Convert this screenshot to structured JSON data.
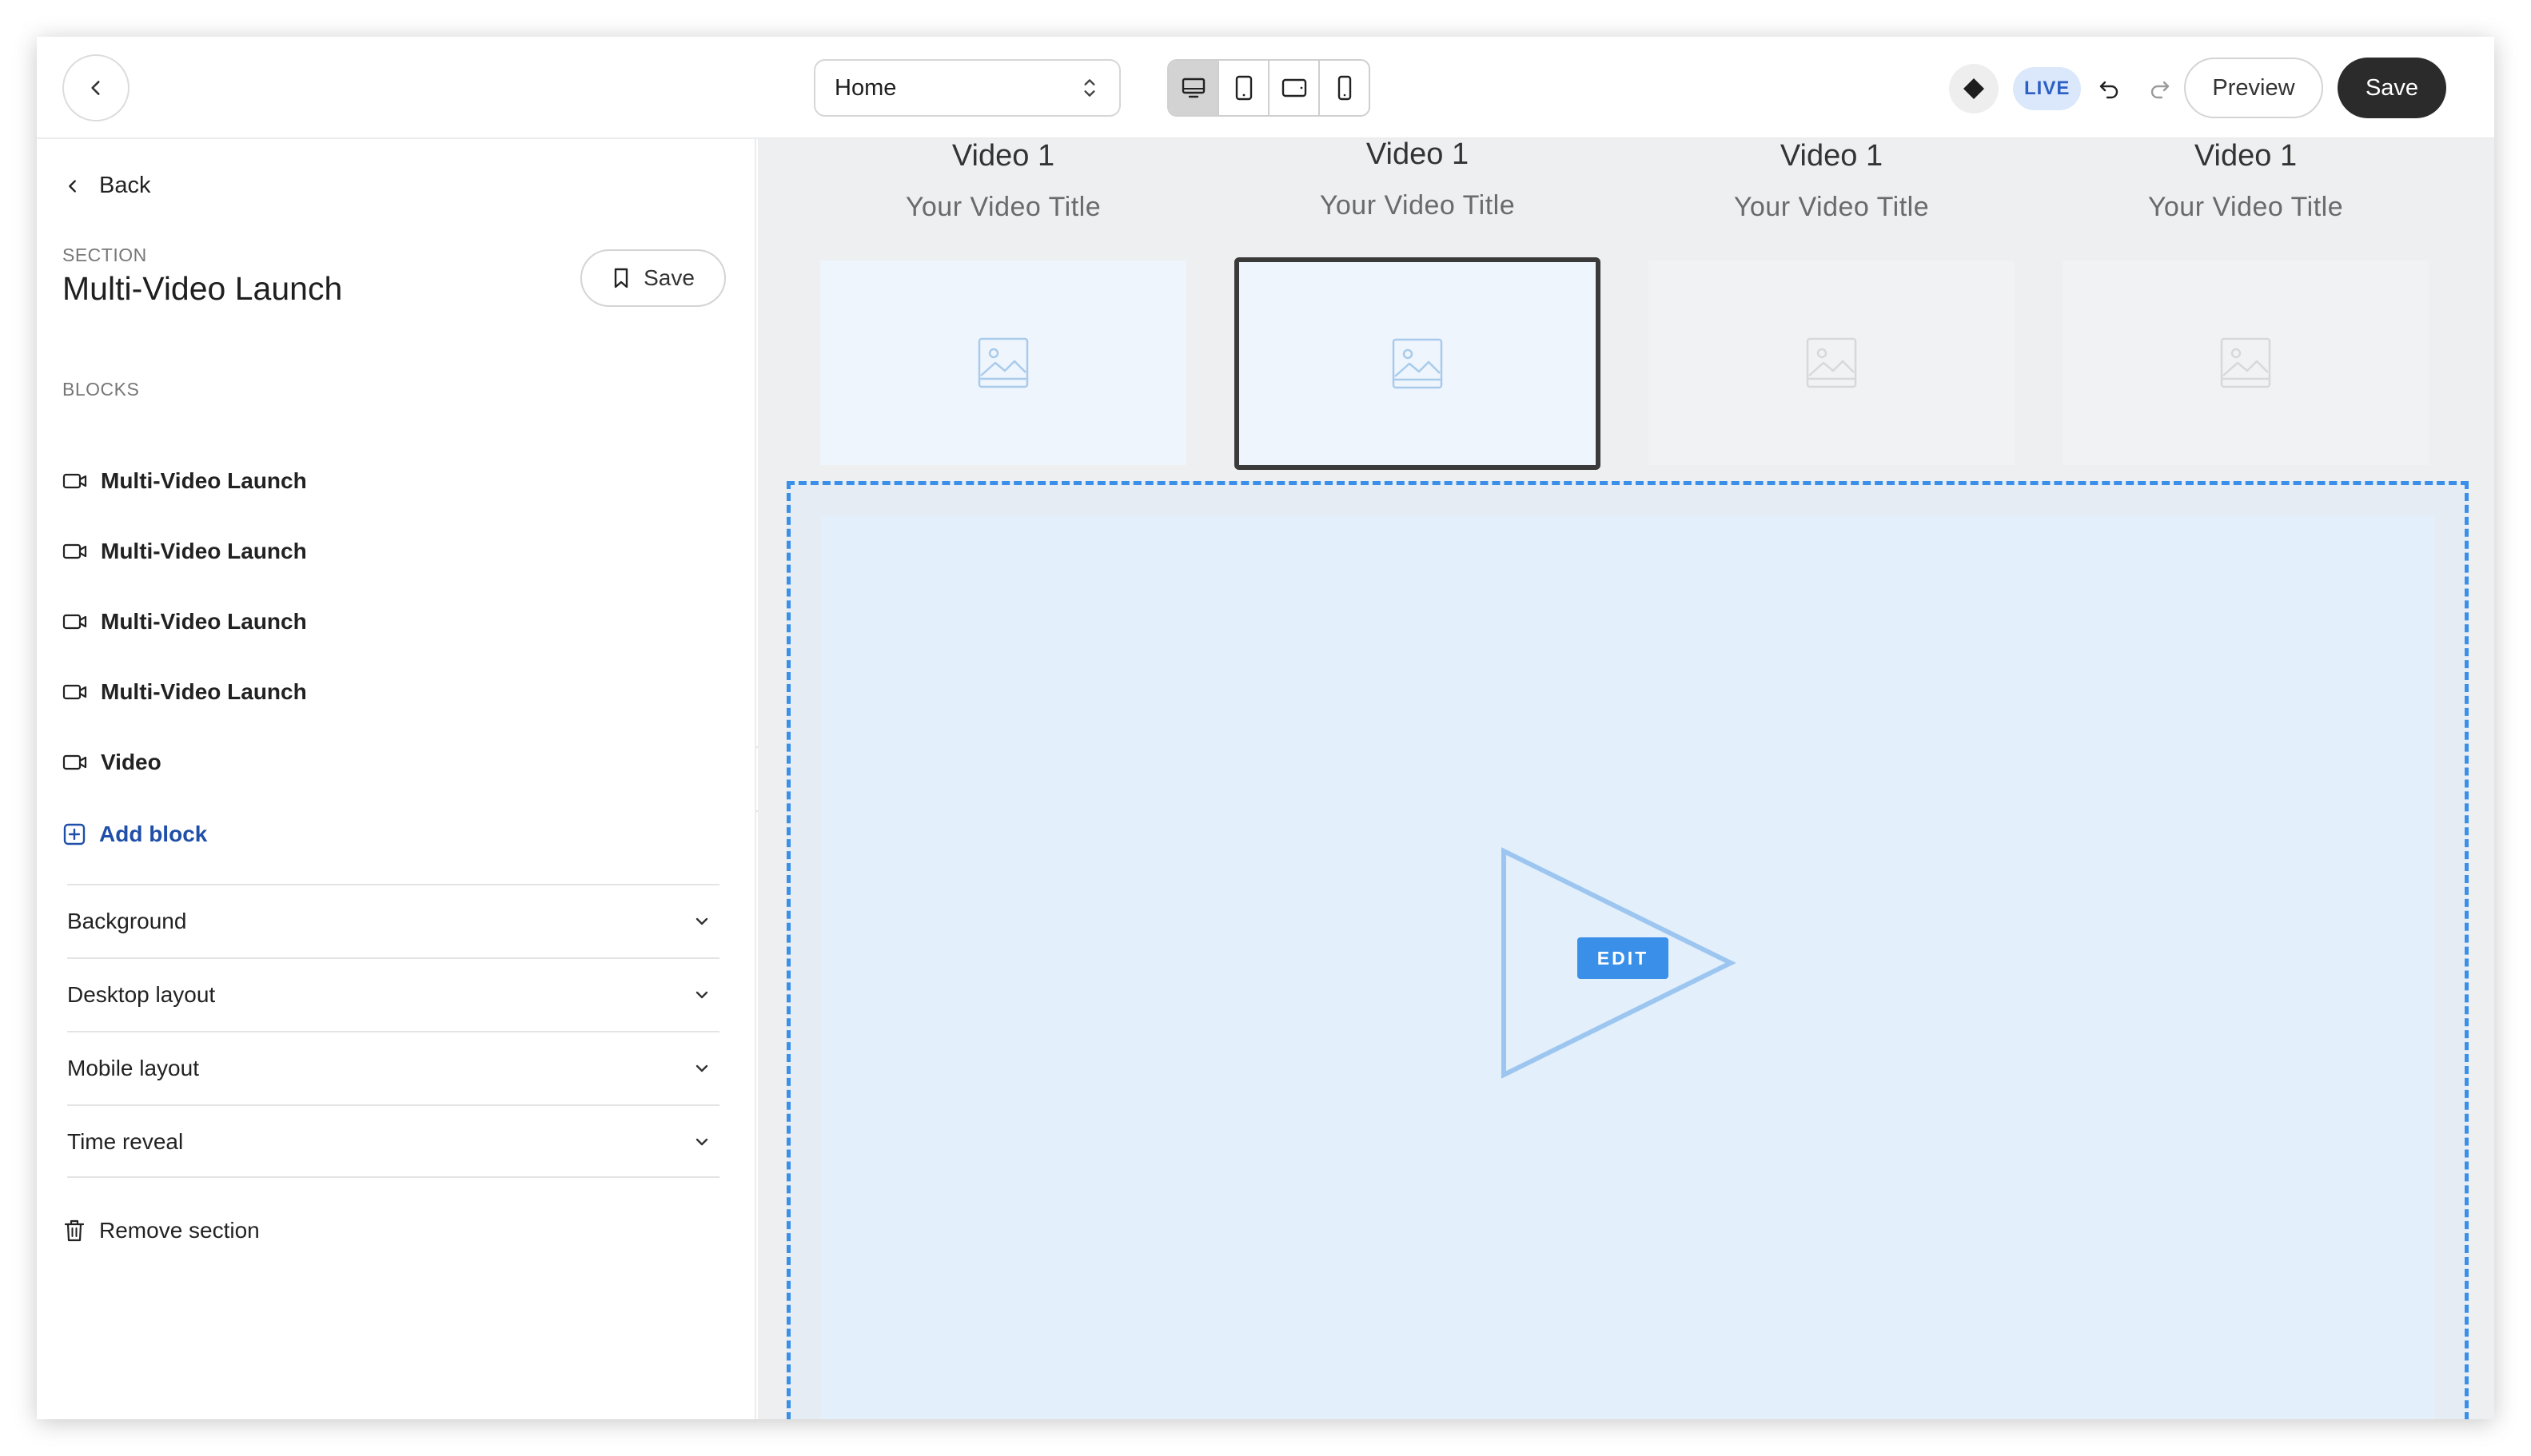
{
  "topbar": {
    "page_select": "Home",
    "live_label": "LIVE",
    "preview_label": "Preview",
    "save_label": "Save"
  },
  "sidebar": {
    "back_label": "Back",
    "section_kicker": "SECTION",
    "section_title": "Multi-Video Launch",
    "save_label": "Save",
    "blocks_kicker": "BLOCKS",
    "blocks": [
      {
        "label": "Multi-Video Launch"
      },
      {
        "label": "Multi-Video Launch"
      },
      {
        "label": "Multi-Video Launch"
      },
      {
        "label": "Multi-Video Launch"
      },
      {
        "label": "Video"
      }
    ],
    "add_block_label": "Add block",
    "accordions": [
      {
        "label": "Background"
      },
      {
        "label": "Desktop layout"
      },
      {
        "label": "Mobile layout"
      },
      {
        "label": "Time reveal"
      }
    ],
    "remove_label": "Remove section"
  },
  "canvas": {
    "videos": [
      {
        "heading": "Video 1",
        "title": "Your Video Title"
      },
      {
        "heading": "Video 1",
        "title": "Your Video Title"
      },
      {
        "heading": "Video 1",
        "title": "Your Video Title"
      },
      {
        "heading": "Video 1",
        "title": "Your Video Title"
      }
    ],
    "edit_label": "EDIT"
  },
  "colors": {
    "accent": "#3a8fe8",
    "save_bg": "#2b2b2b",
    "live_bg": "#dbe7fb",
    "link": "#1f4fa8"
  },
  "icons": [
    "chevron-left-icon",
    "up-down-chevron-icon",
    "desktop-icon",
    "tablet-icon",
    "tablet-landscape-icon",
    "mobile-icon",
    "diamond-icon",
    "undo-icon",
    "redo-icon",
    "bookmark-icon",
    "video-camera-icon",
    "plus-square-icon",
    "chevron-down-icon",
    "trash-icon",
    "image-placeholder-icon",
    "play-icon"
  ]
}
